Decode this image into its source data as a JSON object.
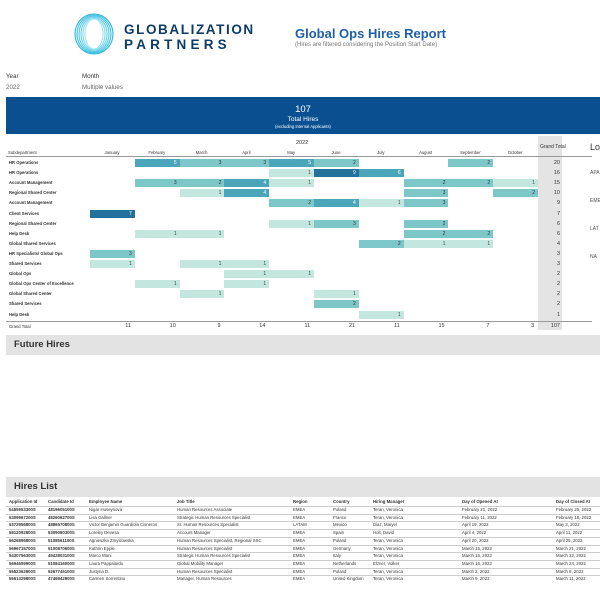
{
  "logo": {
    "line1": "GLOBALIZATION",
    "line2": "PARTNERS"
  },
  "header": {
    "title": "Global Ops Hires Report",
    "subtitle": "(Hires are filtered considering the Position Start Date)"
  },
  "filters": [
    {
      "label": "Year",
      "value": "2022"
    },
    {
      "label": "Month",
      "value": "Multiple values"
    }
  ],
  "kpi": {
    "value": "107",
    "label": "Total Hires",
    "sublabel": "(excluding Internal Applicants)"
  },
  "pivot": {
    "year": "2022",
    "grand_total_header": "Grand Total",
    "subdept_header": "Subdepartment",
    "months": [
      "January",
      "February",
      "March",
      "April",
      "May",
      "June",
      "July",
      "August",
      "September",
      "October"
    ],
    "grand_total_row_label": "Grand Total",
    "rows": [
      {
        "label": "HR Operations",
        "cells": [
          null,
          5,
          3,
          3,
          5,
          2,
          null,
          null,
          2,
          null
        ],
        "total": "20"
      },
      {
        "label": "HR Operations",
        "cells": [
          null,
          null,
          null,
          null,
          1,
          9,
          6,
          null,
          null,
          null
        ],
        "total": "16"
      },
      {
        "label": "Account Management",
        "cells": [
          null,
          3,
          2,
          4,
          1,
          null,
          null,
          2,
          2,
          1
        ],
        "total": "15"
      },
      {
        "label": "Regional Shared Center",
        "cells": [
          null,
          null,
          1,
          4,
          null,
          null,
          null,
          3,
          null,
          2
        ],
        "total": "10"
      },
      {
        "label": "Account Management",
        "cells": [
          null,
          null,
          null,
          null,
          2,
          4,
          1,
          3,
          null,
          null
        ],
        "total": "9"
      },
      {
        "label": "Client Services",
        "cells": [
          7,
          null,
          null,
          null,
          null,
          null,
          null,
          null,
          null,
          null
        ],
        "total": "7"
      },
      {
        "label": "Regional Shared Center",
        "cells": [
          null,
          null,
          null,
          null,
          1,
          3,
          null,
          2,
          null,
          null
        ],
        "total": "6"
      },
      {
        "label": "Help Desk",
        "cells": [
          null,
          1,
          1,
          null,
          null,
          null,
          null,
          2,
          2,
          null
        ],
        "total": "6"
      },
      {
        "label": "Global Shared Services",
        "cells": [
          null,
          null,
          null,
          null,
          null,
          null,
          2,
          1,
          1,
          null
        ],
        "total": "4"
      },
      {
        "label": "HR Specialists/ Global Ops",
        "cells": [
          3,
          null,
          null,
          null,
          null,
          null,
          null,
          null,
          null,
          null
        ],
        "total": "3"
      },
      {
        "label": "Shared Services",
        "cells": [
          1,
          null,
          1,
          1,
          null,
          null,
          null,
          null,
          null,
          null
        ],
        "total": "3"
      },
      {
        "label": "Global Ops",
        "cells": [
          null,
          null,
          null,
          1,
          1,
          null,
          null,
          null,
          null,
          null
        ],
        "total": "2"
      },
      {
        "label": "Global Ops Center of Excellence",
        "cells": [
          null,
          1,
          null,
          1,
          null,
          null,
          null,
          null,
          null,
          null
        ],
        "total": "2"
      },
      {
        "label": "Global Shared Center",
        "cells": [
          null,
          null,
          1,
          null,
          null,
          1,
          null,
          null,
          null,
          null
        ],
        "total": "2"
      },
      {
        "label": "Shared Services",
        "cells": [
          null,
          null,
          null,
          null,
          null,
          2,
          null,
          null,
          null,
          null
        ],
        "total": "2"
      },
      {
        "label": "Help Desk",
        "cells": [
          null,
          null,
          null,
          null,
          null,
          null,
          1,
          null,
          null,
          null
        ],
        "total": "1"
      }
    ],
    "grand_totals": [
      "11",
      "10",
      "9",
      "14",
      "11",
      "21",
      "11",
      "15",
      "7",
      "3"
    ],
    "grand_total_all": "107"
  },
  "location_panel": {
    "title": "Lo",
    "items": [
      "APA",
      "EME",
      "LAT",
      "NA"
    ]
  },
  "sections": {
    "future": "Future Hires",
    "hires": "Hires List"
  },
  "hires_list": {
    "columns": [
      "Application Id",
      "Candidate Id",
      "Employee Name",
      "Job Title",
      "Region",
      "Country",
      "Hiring Manager",
      "Day of Opened At",
      "Day of Closed At"
    ],
    "rows": [
      [
        "5455953300S",
        "4819605100S",
        "Nigar Huseynova",
        "Human Resources Associate",
        "EMEA",
        "Poland",
        "Teran, Veronica",
        "February 21, 2022",
        "February 25, 2022"
      ],
      [
        "5309967200S",
        "4826062700S",
        "Lisa Gallner",
        "Strategic Human Resources Specialist",
        "EMEA",
        "France",
        "Teran, Veronica",
        "February 11, 2022",
        "February 18, 2022"
      ],
      [
        "5372956800S",
        "4886570800S",
        "Victor Benjamin Guardiola Cisneros",
        "Sr. Human Resources Specialist",
        "LATAM",
        "Mexico",
        "Diaz, Maryel",
        "April 19, 2022",
        "May 3, 2022"
      ],
      [
        "5812092800S",
        "5309080300S",
        "Loreley Devesa",
        "Account Manager",
        "EMEA",
        "Spain",
        "Holt, David",
        "April 4, 2022",
        "April 11, 2022"
      ],
      [
        "5626896800S",
        "5108561100S",
        "Agnieszka Zmyslowska",
        "Human Resources Specialist, Regional SSC",
        "EMEA",
        "Poland",
        "Teran, Veronica",
        "April 20, 2022",
        "April 25, 2022"
      ],
      [
        "5696715700S",
        "5100870600S",
        "Kathrin Epple",
        "Human Resources Specialist",
        "EMEA",
        "Germany",
        "Teran, Veronica",
        "March 15, 2022",
        "March 21, 2022"
      ],
      [
        "5430756300S",
        "4942803100S",
        "Marco Mani",
        "Strategic Human Resources Specialist",
        "EMEA",
        "Italy",
        "Teran, Veronica",
        "March 15, 2022",
        "March 22, 2022"
      ],
      [
        "5694659900S",
        "5108416000S",
        "Laura Pappalardo",
        "Global Mobility Manager",
        "EMEA",
        "Netherlands",
        "Elzner, Volker",
        "March 16, 2022",
        "March 24, 2022"
      ],
      [
        "5552362800S",
        "5267745100S",
        "Justyna D.",
        "Human Resources Specialist",
        "EMEA",
        "Poland",
        "Teran, Veronica",
        "March 2, 2022",
        "March 8, 2022"
      ],
      [
        "5561329800S",
        "4746842900S",
        "Carmen Sorrentino",
        "Manager, Human Resources",
        "EMEA",
        "United Kingdom",
        "Teran, Veronica",
        "March 9, 2022",
        "March 11, 2022"
      ]
    ]
  }
}
